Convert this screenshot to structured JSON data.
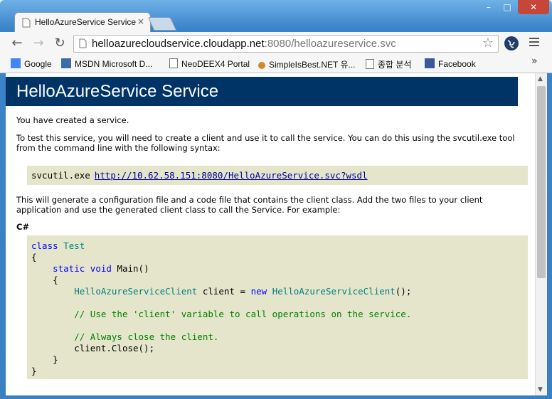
{
  "window": {
    "tab_title": "HelloAzureService Service",
    "tab_close": "×",
    "controls": {
      "minimize": "–",
      "maximize": "□",
      "close": "✕"
    }
  },
  "toolbar": {
    "back": "←",
    "forward": "→",
    "reload": "↻",
    "url_host": "helloazurecloudservice.cloudapp.net",
    "url_rest": ":8080/helloazureservice.svc",
    "star": "☆"
  },
  "bookmarks": [
    {
      "label": "Google",
      "icon": "google-icon",
      "color": "#4285f4"
    },
    {
      "label": "MSDN Microsoft D...",
      "icon": "msdn-icon",
      "color": "#3b6ea8"
    },
    {
      "label": "NeoDEEX4 Portal",
      "icon": "page-icon",
      "color": "#ffffff"
    },
    {
      "label": "SimpleIsBest.NET 유...",
      "icon": "key-icon",
      "color": "#d08a2c"
    },
    {
      "label": "종합 분석",
      "icon": "page-icon",
      "color": "#ffffff"
    },
    {
      "label": "Facebook",
      "icon": "facebook-icon",
      "color": "#3b5998"
    }
  ],
  "bookmarks_more": "»",
  "page": {
    "heading": "HelloAzureService Service",
    "intro": "You have created a service.",
    "test_instructions": "To test this service, you will need to create a client and use it to call the service. You can do this using the svcutil.exe tool from the command line with the following syntax:",
    "command": "svcutil.exe",
    "wsdl_link": "http://10.62.58.151:8080/HelloAzureService.svc?wsdl",
    "generate_text": "This will generate a configuration file and a code file that contains the client class. Add the two files to your client application and use the generated client class to call the Service. For example:",
    "language_label": "C#",
    "code": {
      "l1_kw": "class",
      "l1_ty": "Test",
      "l2": "{",
      "l3_kw1": "static",
      "l3_kw2": "void",
      "l3_rest": "Main()",
      "l4": "{",
      "l5_ty1": "HelloAzureServiceClient",
      "l5_mid": "client =",
      "l5_kw": "new",
      "l5_ty2": "HelloAzureServiceClient",
      "l5_end": "();",
      "l6_cm": "// Use the 'client' variable to call operations on the service.",
      "l7_cm": "// Always close the client.",
      "l8": "client.Close();",
      "l9": "}",
      "l10": "}"
    }
  },
  "colors": {
    "heading_bg": "#003366",
    "code_bg": "#e5e5cc",
    "frame": "#3b83c8",
    "close_btn": "#c7463a"
  }
}
